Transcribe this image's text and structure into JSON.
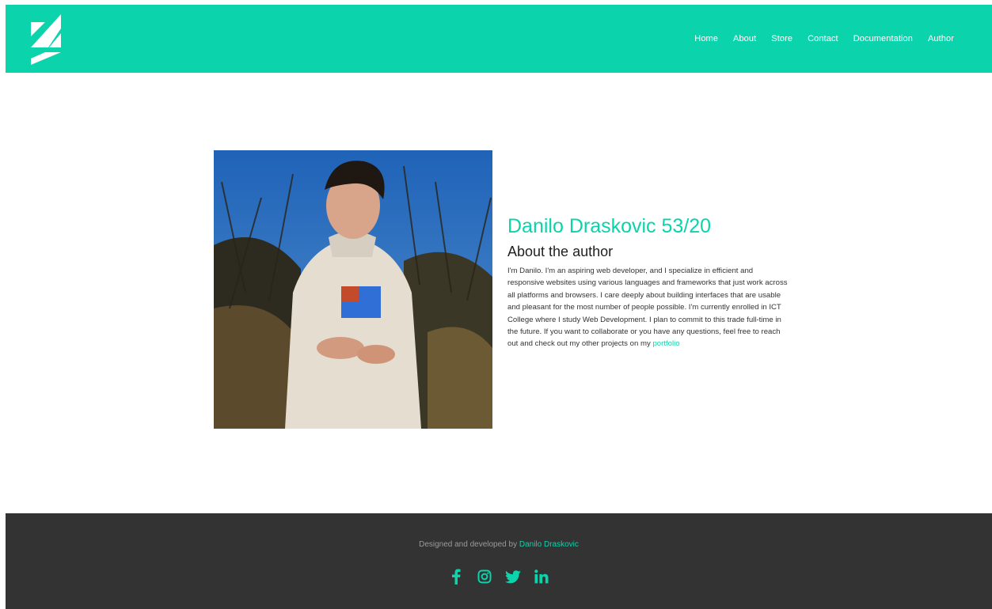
{
  "nav": {
    "links": [
      "Home",
      "About",
      "Store",
      "Contact",
      "Documentation",
      "Author"
    ]
  },
  "author": {
    "name": "Danilo Draskovic 53/20",
    "subtitle": "About the author",
    "bio": "I'm Danilo. I'm an aspiring web developer, and I specialize in efficient and responsive websites using various languages and frameworks that just work across all platforms and browsers. I care deeply about building interfaces that are usable and pleasant for the most number of people possible. I'm currently enrolled in ICT College where I study Web Development. I plan to commit to this trade full-time in the future. If you want to collaborate or you have any questions, feel free to reach out and check out my other projects on my",
    "portfolio_link": "portfolio"
  },
  "footer": {
    "credits_prefix": "Designed and developed by",
    "credits_name": "Danilo Draskovic",
    "socials": [
      "facebook-icon",
      "instagram-icon",
      "twitter-icon",
      "linkedin-icon"
    ]
  },
  "colors": {
    "accent": "#0bd3ac",
    "footer_bg": "#333333"
  }
}
